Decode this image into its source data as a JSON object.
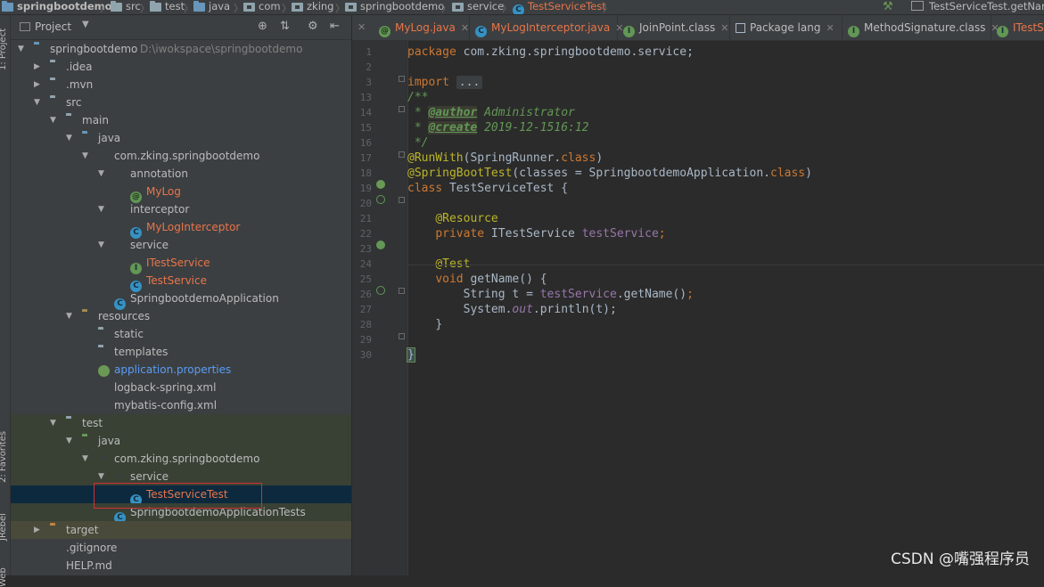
{
  "breadcrumb": {
    "items": [
      {
        "label": "springbootdemo",
        "icon": "module-folder-icon"
      },
      {
        "label": "src",
        "icon": "folder-icon"
      },
      {
        "label": "test",
        "icon": "folder-icon"
      },
      {
        "label": "java",
        "icon": "folder-icon"
      },
      {
        "label": "com",
        "icon": "package-icon"
      },
      {
        "label": "zking",
        "icon": "package-icon"
      },
      {
        "label": "springbootdemo",
        "icon": "package-icon"
      },
      {
        "label": "service",
        "icon": "package-icon"
      },
      {
        "label": "TestServiceTest",
        "icon": "class-icon"
      }
    ],
    "run_config": "TestServiceTest.getName"
  },
  "left_stripe": {
    "project_label": "1: Project",
    "favorites_label": "2: Favorites",
    "jrebel_label": "JRebel",
    "web_label": "Web"
  },
  "project_panel": {
    "title": "Project",
    "tree": [
      {
        "label": "springbootdemo",
        "hint": "D:\\iwokspace\\springbootdemo",
        "depth": 0,
        "arrow": "open",
        "icon": "module"
      },
      {
        "label": ".idea",
        "depth": 1,
        "arrow": "closed",
        "icon": "folder"
      },
      {
        "label": ".mvn",
        "depth": 1,
        "arrow": "closed",
        "icon": "folder"
      },
      {
        "label": "src",
        "depth": 1,
        "arrow": "open",
        "icon": "folder"
      },
      {
        "label": "main",
        "depth": 2,
        "arrow": "open",
        "icon": "folder"
      },
      {
        "label": "java",
        "depth": 3,
        "arrow": "open",
        "icon": "source-folder"
      },
      {
        "label": "com.zking.springbootdemo",
        "depth": 4,
        "arrow": "open",
        "icon": "package"
      },
      {
        "label": "annotation",
        "depth": 5,
        "arrow": "open",
        "icon": "package"
      },
      {
        "label": "MyLog",
        "depth": 6,
        "icon": "annotation",
        "color": "red"
      },
      {
        "label": "interceptor",
        "depth": 5,
        "arrow": "open",
        "icon": "package"
      },
      {
        "label": "MyLogInterceptor",
        "depth": 6,
        "icon": "class",
        "color": "red"
      },
      {
        "label": "service",
        "depth": 5,
        "arrow": "open",
        "icon": "package"
      },
      {
        "label": "ITestService",
        "depth": 6,
        "icon": "interface",
        "color": "red"
      },
      {
        "label": "TestService",
        "depth": 6,
        "icon": "class",
        "color": "red"
      },
      {
        "label": "SpringbootdemoApplication",
        "depth": 5,
        "icon": "spring-class"
      },
      {
        "label": "resources",
        "depth": 3,
        "arrow": "open",
        "icon": "resources-folder"
      },
      {
        "label": "static",
        "depth": 4,
        "icon": "folder"
      },
      {
        "label": "templates",
        "depth": 4,
        "icon": "folder"
      },
      {
        "label": "application.properties",
        "depth": 4,
        "icon": "spring-properties",
        "color": "blue"
      },
      {
        "label": "logback-spring.xml",
        "depth": 4,
        "icon": "xml"
      },
      {
        "label": "mybatis-config.xml",
        "depth": 4,
        "icon": "xml"
      },
      {
        "label": "test",
        "depth": 2,
        "arrow": "open",
        "icon": "folder"
      },
      {
        "label": "java",
        "depth": 3,
        "arrow": "open",
        "icon": "test-folder"
      },
      {
        "label": "com.zking.springbootdemo",
        "depth": 4,
        "arrow": "open",
        "icon": "package"
      },
      {
        "label": "service",
        "depth": 5,
        "arrow": "open",
        "icon": "package"
      },
      {
        "label": "TestServiceTest",
        "depth": 6,
        "icon": "test-class",
        "color": "red",
        "selected": true
      },
      {
        "label": "SpringbootdemoApplicationTests",
        "depth": 5,
        "icon": "test-class"
      },
      {
        "label": "target",
        "depth": 1,
        "arrow": "closed",
        "icon": "folder-orange"
      },
      {
        "label": ".gitignore",
        "depth": 1,
        "icon": "file"
      },
      {
        "label": "HELP.md",
        "depth": 1,
        "icon": "md"
      }
    ]
  },
  "editor": {
    "tabs": [
      {
        "label": "MyLog.java",
        "icon": "annotation",
        "color": "red"
      },
      {
        "label": "MyLogInterceptor.java",
        "icon": "class",
        "color": "red"
      },
      {
        "label": "JoinPoint.class",
        "icon": "interface"
      },
      {
        "label": "Package lang",
        "icon": "package"
      },
      {
        "label": "MethodSignature.class",
        "icon": "interface"
      },
      {
        "label": "ITestS",
        "icon": "interface",
        "color": "red"
      }
    ],
    "line_numbers": [
      "1",
      "2",
      "3",
      "13",
      "14",
      "15",
      "16",
      "17",
      "18",
      "19",
      "20",
      "21",
      "22",
      "23",
      "24",
      "25",
      "26",
      "27",
      "28",
      "29",
      "30"
    ],
    "code": {
      "l1_kw": "package",
      "l1_rest": " com.zking.springbootdemo.service;",
      "l3_kw": "import",
      "l3_folded": "...",
      "l13": "/**",
      "l14_pre": " * ",
      "l14_tag": "@author",
      "l14_text": " Administrator",
      "l15_pre": " * ",
      "l15_tag": "@create",
      "l15_text": " 2019-12-1516:12",
      "l16": " */",
      "l17_ann": "@RunWith",
      "l17_a": "(SpringRunner.",
      "l17_kw": "class",
      "l17_b": ")",
      "l18_ann": "@SpringBootTest",
      "l18_a": "(classes = SpringbootdemoApplication.",
      "l18_kw": "class",
      "l18_b": ")",
      "l19_kw": "class",
      "l19_rest": " TestServiceTest ",
      "l19_brace": "{",
      "l21_ann": "@Resource",
      "l22_kw": "private",
      "l22_type": " ITestService ",
      "l22_fld": "testService",
      "l22_end": ";",
      "l24_ann": "@Test",
      "l25_kw": "void",
      "l25_rest": " getName() {",
      "l26_a": "String t = ",
      "l26_fld": "testService",
      "l26_b": ".getName()",
      ";": ";",
      "l27_a": "System.",
      "l27_out": "out",
      "l27_b": ".println(t);",
      "l28": "}",
      "l30": "}"
    }
  },
  "watermark": "CSDN @嘴强程序员",
  "colors": {
    "selection": "#0d293e",
    "highlight_border": "#d32f2f",
    "keyword": "#cc7832",
    "annotation": "#bbb529",
    "doc": "#629755"
  }
}
